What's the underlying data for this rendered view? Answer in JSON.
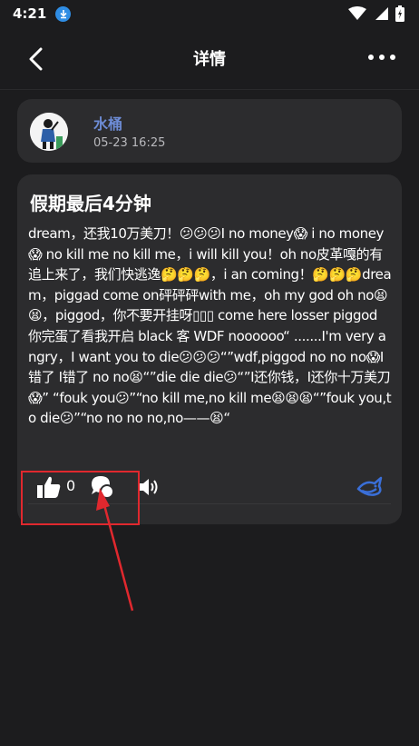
{
  "status_bar": {
    "time": "4:21"
  },
  "header": {
    "title": "详情"
  },
  "author": {
    "name": "水桶",
    "time": "05-23 16:25"
  },
  "post": {
    "title": "假期最后4分钟",
    "body": "dream，还我10万美刀！😕😕😕I no money😱 i no money😱 no kill me no kill me，i will kill you！oh no皮革嘎的有追上来了，我们快逃逸🤔🤔🤔，i an coming！🤔🤔🤔dream，piggad come on砰砰砰with me，oh my god oh no😫😫，piggod，你不要开挂呀▯▯▯ come here losser piggod 你完蛋了看我开启 black 客 WDF noooooo“ .......I'm very angry，I want you to die😕😕😕“”wdf,piggod no no no😱I错了 I错了 no no😫“”die die die😕“”I还你钱，I还你十万美刀😱” “fouk you😕”“no kill me,no kill me😫😫😫“”fouk you,to die😕”“no no no no,no——😫“"
  },
  "actions": {
    "like_count": "0"
  },
  "icons": [
    "back-arrow-icon",
    "more-icon",
    "thumbs-up-icon",
    "comment-icon",
    "audio-icon",
    "fish-icon",
    "download-icon",
    "wifi-icon",
    "signal-icon",
    "battery-icon"
  ],
  "colors": {
    "background": "#1c1c1e",
    "card": "#2c2c2e",
    "author_name": "#6d8cd6",
    "highlight": "#e0282e",
    "fish_icon": "#3a6fd8"
  }
}
